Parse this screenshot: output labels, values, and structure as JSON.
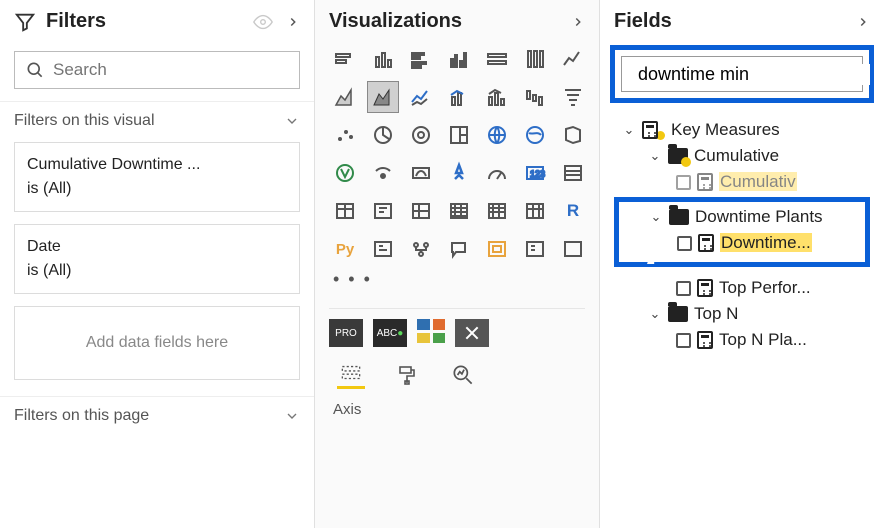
{
  "filters": {
    "title": "Filters",
    "search_placeholder": "Search",
    "section_visual": "Filters on this visual",
    "cards": [
      {
        "title": "Cumulative Downtime ...",
        "value": "is (All)"
      },
      {
        "title": "Date",
        "value": "is (All)"
      }
    ],
    "drop_hint": "Add data fields here",
    "section_page": "Filters on this page"
  },
  "viz": {
    "title": "Visualizations",
    "axis_label": "Axis",
    "py_label": "Py",
    "r_label": "R"
  },
  "fields": {
    "title": "Fields",
    "search_value": "downtime min",
    "tree": {
      "key_measures": "Key Measures",
      "cumulative": "Cumulative",
      "cumulative_item": "Cumulativ",
      "downtime_plants": "Downtime Plants",
      "downtime_item": "Downtime...",
      "top_perfor": "Top Perfor...",
      "top_n": "Top N",
      "top_n_pla": "Top N Pla..."
    }
  }
}
